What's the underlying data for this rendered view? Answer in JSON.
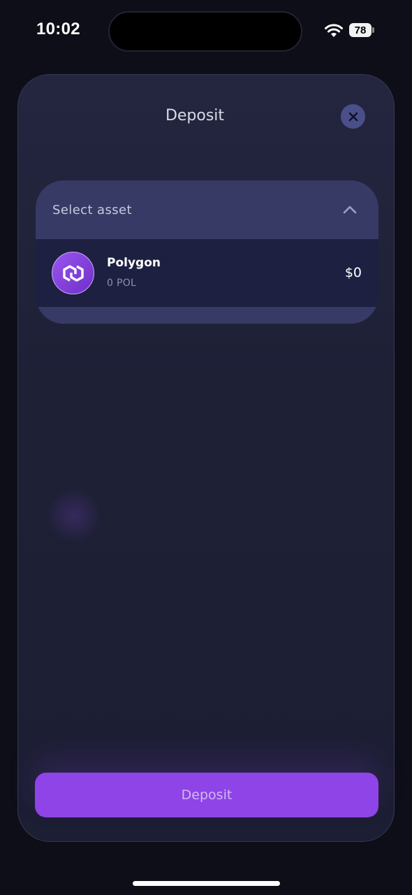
{
  "status_bar": {
    "time": "10:02",
    "battery": "78",
    "wifi_icon": "wifi-icon"
  },
  "modal": {
    "title": "Deposit",
    "close_icon": "close-icon"
  },
  "asset_select": {
    "label": "Select asset",
    "expanded": true,
    "assets": [
      {
        "name": "Polygon",
        "balance": "0 POL",
        "value": "$0",
        "icon": "polygon-logo-icon"
      }
    ]
  },
  "actions": {
    "deposit_label": "Deposit"
  },
  "colors": {
    "accent": "#8e44e6",
    "modal_background": "#1e2036",
    "dropdown_header": "#363a64",
    "dropdown_list": "#1d2040",
    "close_button": "#4a4f8a"
  }
}
